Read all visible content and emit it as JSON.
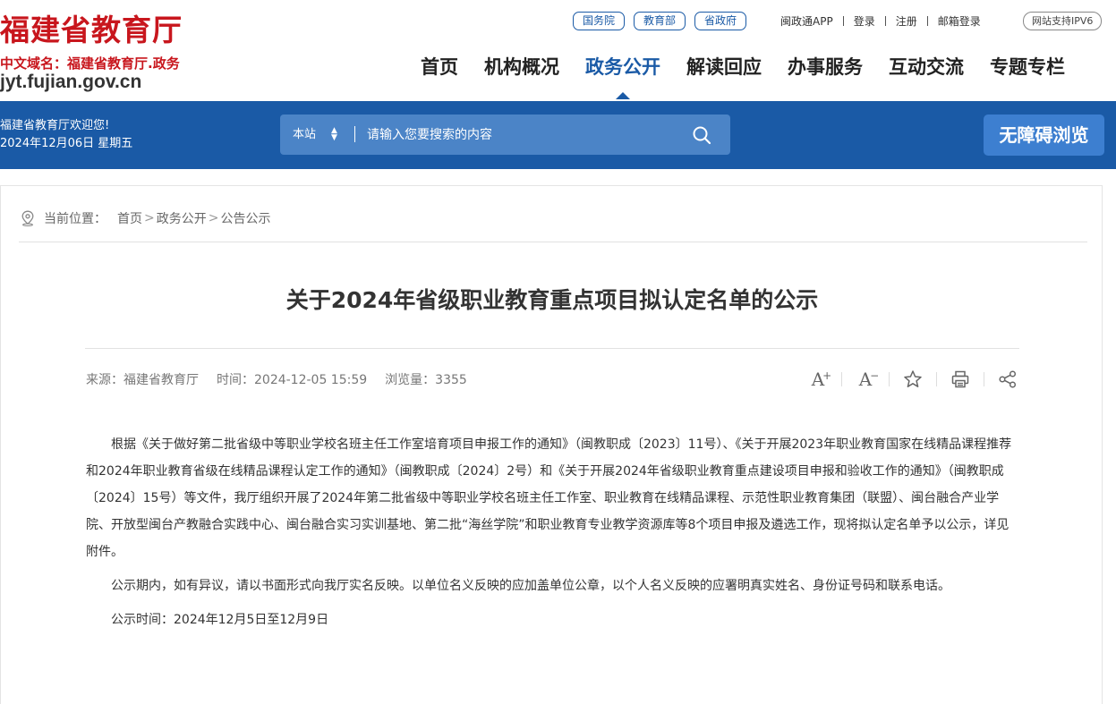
{
  "header": {
    "site_name": "福建省教育厅",
    "domain_label": "中文域名：福建省教育厅.政务",
    "url": "jyt.fujian.gov.cn",
    "quick_links": [
      "国务院",
      "教育部",
      "省政府"
    ],
    "top_links": [
      "闽政通APP",
      "登录",
      "注册",
      "邮箱登录"
    ],
    "ipv6_badge": "网站支持IPV6",
    "nav": [
      "首页",
      "机构概况",
      "政务公开",
      "解读回应",
      "办事服务",
      "互动交流",
      "专题专栏"
    ],
    "active_nav": "政务公开"
  },
  "bluebar": {
    "welcome": "福建省教育厅欢迎您!",
    "date": "2024年12月06日 星期五",
    "search_scope": "本站",
    "search_placeholder": "请输入您要搜索的内容",
    "accessibility_label": "无障碍浏览"
  },
  "breadcrumb": {
    "label": "当前位置：",
    "items": [
      "首页",
      "政务公开",
      "公告公示"
    ]
  },
  "article": {
    "title": "关于2024年省级职业教育重点项目拟认定名单的公示",
    "source": "来源：福建省教育厅",
    "time": "时间：2024-12-05 15:59",
    "views": "浏览量：3355",
    "paragraphs": [
      "根据《关于做好第二批省级中等职业学校名班主任工作室培育项目申报工作的通知》（闽教职成〔2023〕11号）、《关于开展2023年职业教育国家在线精品课程推荐和2024年职业教育省级在线精品课程认定工作的通知》（闽教职成〔2024〕2号）和《关于开展2024年省级职业教育重点建设项目申报和验收工作的通知》（闽教职成〔2024〕15号）等文件，我厅组织开展了2024年第二批省级中等职业学校名班主任工作室、职业教育在线精品课程、示范性职业教育集团（联盟）、闽台融合产业学院、开放型闽台产教融合实践中心、闽台融合实习实训基地、第二批“海丝学院”和职业教育专业教学资源库等8个项目申报及遴选工作，现将拟认定名单予以公示，详见附件。",
      "公示期内，如有异议，请以书面形式向我厅实名反映。以单位名义反映的应加盖单位公章，以个人名义反映的应署明真实姓名、身份证号码和联系电话。",
      "公示时间：2024年12月5日至12月9日"
    ]
  },
  "colors": {
    "brand_red": "#c8161d",
    "brand_blue": "#1a5aa6"
  },
  "icons": [
    "location-icon",
    "search-icon",
    "font-increase-icon",
    "font-decrease-icon",
    "star-icon",
    "print-icon",
    "share-icon"
  ]
}
